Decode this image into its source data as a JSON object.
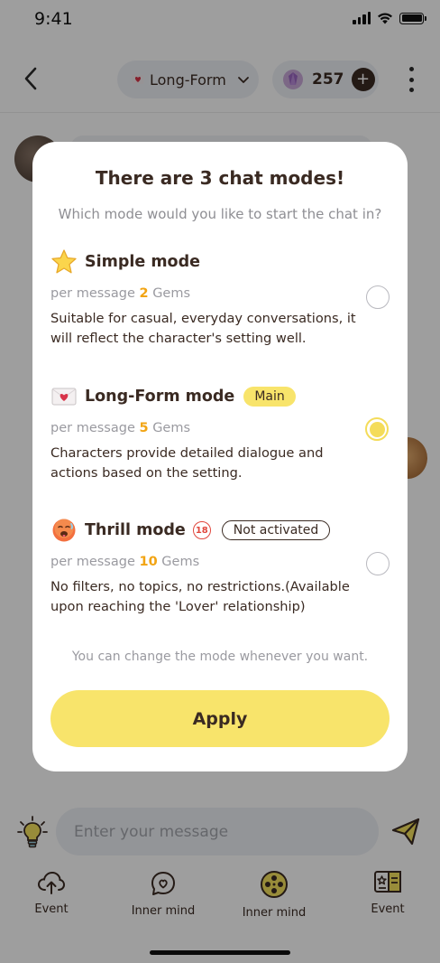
{
  "status_bar": {
    "time": "9:41"
  },
  "header": {
    "mode_label": "Long-Form",
    "gem_count": "257",
    "gem_plus": "+"
  },
  "input": {
    "placeholder": "Enter your message"
  },
  "tabs": [
    {
      "label": "Event",
      "icon": "cloud-upload-icon"
    },
    {
      "label": "Inner mind",
      "icon": "heart-chat-icon"
    },
    {
      "label": "Inner mind",
      "icon": "film-reel-icon"
    },
    {
      "label": "Event",
      "icon": "card-list-icon"
    }
  ],
  "modal": {
    "title": "There are 3 chat modes!",
    "subtitle": "Which mode would you like to start the chat in?",
    "price_prefix": "per message",
    "price_suffix": "Gems",
    "options": [
      {
        "name": "Simple mode",
        "icon": "star-icon",
        "gems": "2",
        "description": "Suitable for casual, everyday conversations, it will reflect the character's setting well.",
        "selected": false
      },
      {
        "name": "Long-Form mode",
        "icon": "love-letter-icon",
        "badge": "Main",
        "gems": "5",
        "description": "Characters provide detailed dialogue and actions based on the setting.",
        "selected": true
      },
      {
        "name": "Thrill mode",
        "icon": "hot-face-icon",
        "age_badge": "18",
        "status_badge": "Not activated",
        "gems": "10",
        "description": "No filters, no topics, no restrictions.(Available upon reaching the 'Lover' relationship)",
        "selected": false
      }
    ],
    "note": "You can change the mode whenever you want.",
    "apply_label": "Apply"
  },
  "colors": {
    "accent_yellow": "#f8e46b",
    "gem_orange": "#f2a413",
    "text_dark": "#3a2a22",
    "alert_red": "#e0473d"
  }
}
